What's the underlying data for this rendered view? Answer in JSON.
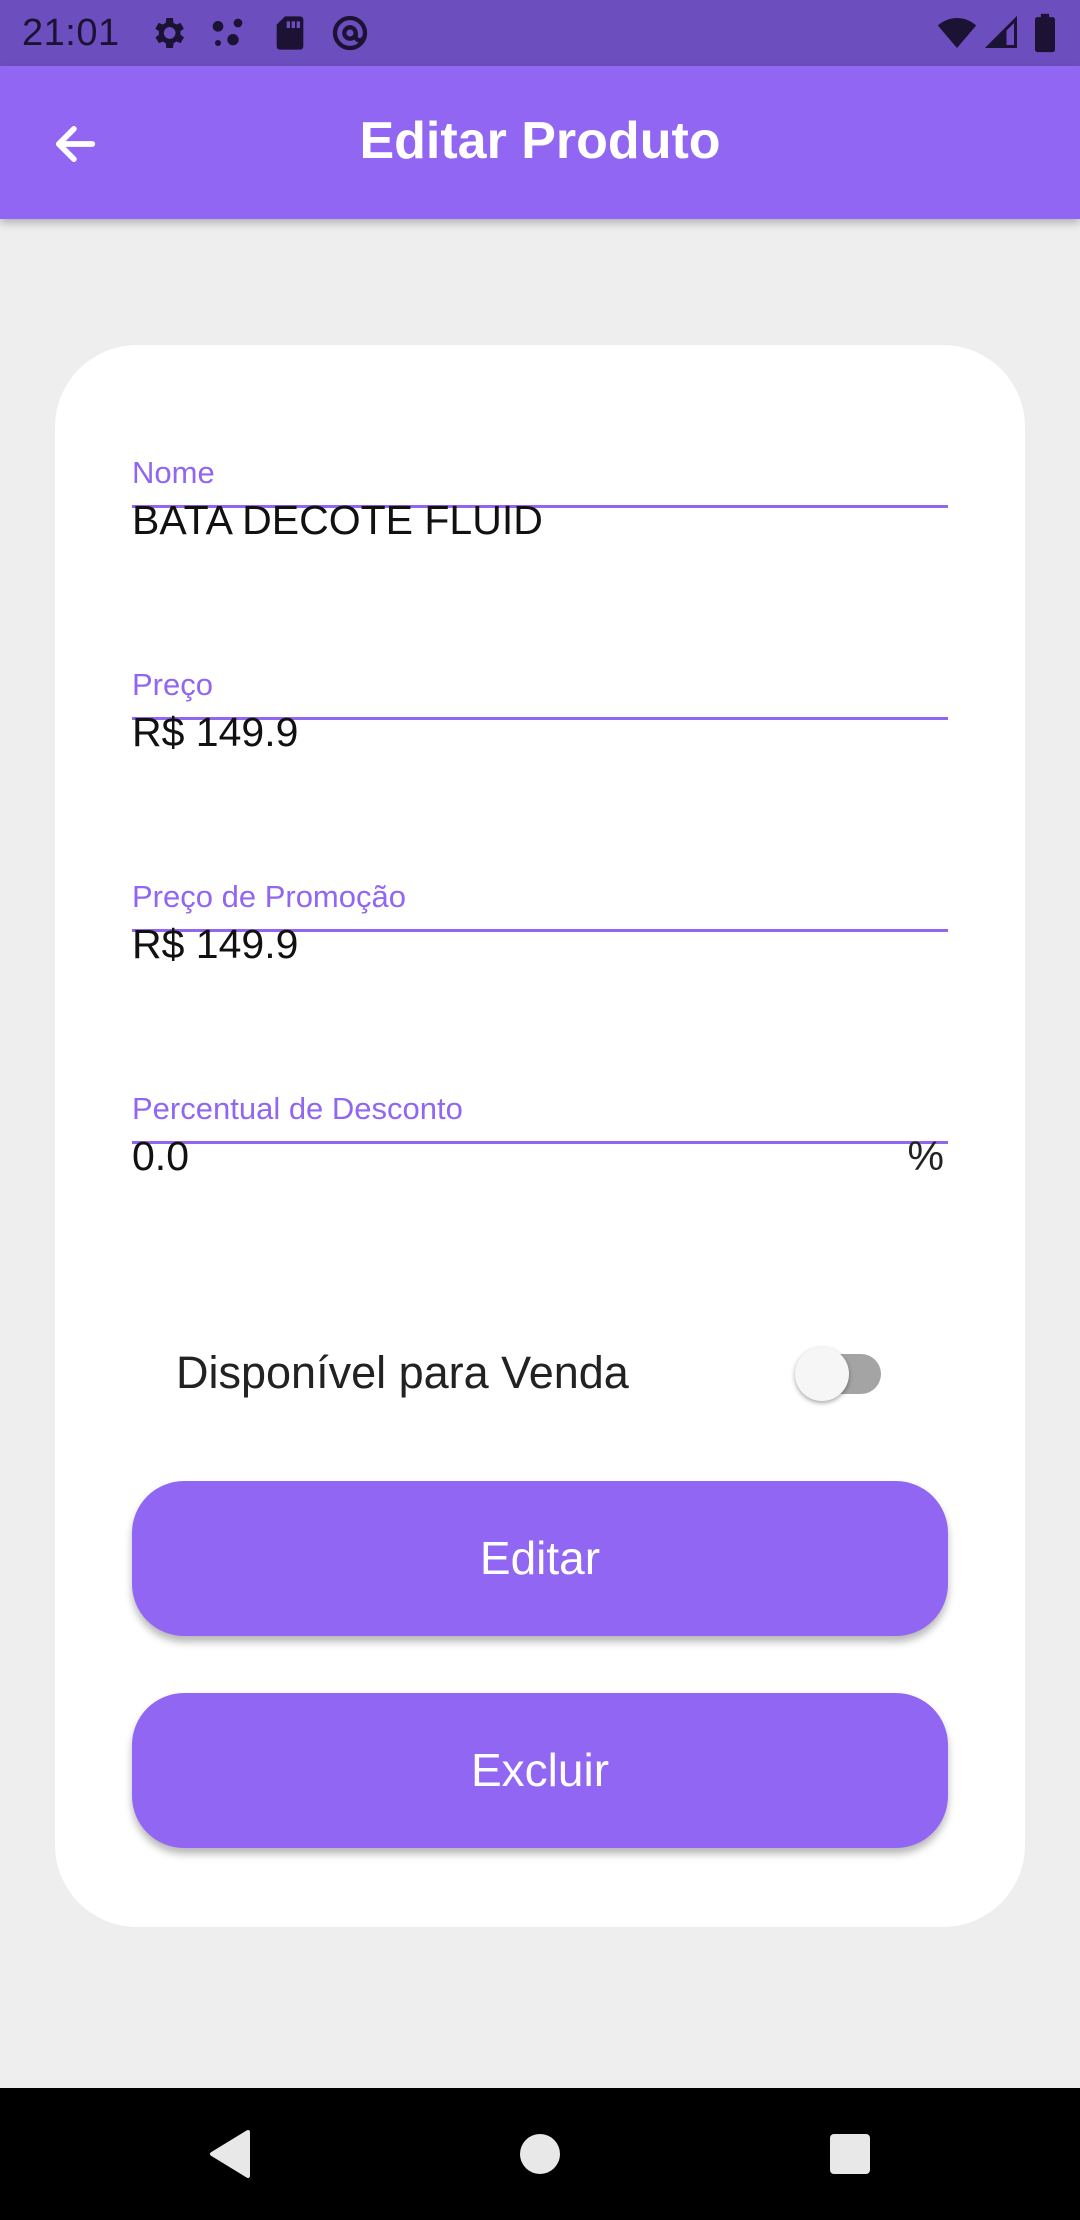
{
  "status_bar": {
    "time": "21:01",
    "left_icons": [
      "settings-gear-icon",
      "connection-dots-icon",
      "sd-card-icon",
      "at-sign-icon"
    ],
    "right_icons": [
      "wifi-icon",
      "cell-signal-icon",
      "battery-icon"
    ]
  },
  "app_bar": {
    "title": "Editar Produto",
    "back_icon": "arrow-back-icon"
  },
  "form": {
    "nome": {
      "label": "Nome",
      "value": "BATA DECOTE FLUID"
    },
    "preco": {
      "label": "Preço",
      "value": "R$ 149.9"
    },
    "preco_promocao": {
      "label": "Preço de Promoção",
      "value": "R$ 149.9"
    },
    "percentual_desconto": {
      "label": "Percentual de Desconto",
      "value": "0.0",
      "suffix": "%"
    },
    "disponivel": {
      "label": "Disponível para Venda",
      "checked": false
    }
  },
  "buttons": {
    "editar": "Editar",
    "excluir": "Excluir"
  },
  "nav_bar": {
    "icons": [
      "back-triangle-icon",
      "home-circle-icon",
      "recents-square-icon"
    ]
  },
  "colors": {
    "status_bar": "#6c4ebf",
    "primary": "#9166f3",
    "background": "#eeeeee",
    "card": "#ffffff",
    "nav_bar": "#000000"
  }
}
